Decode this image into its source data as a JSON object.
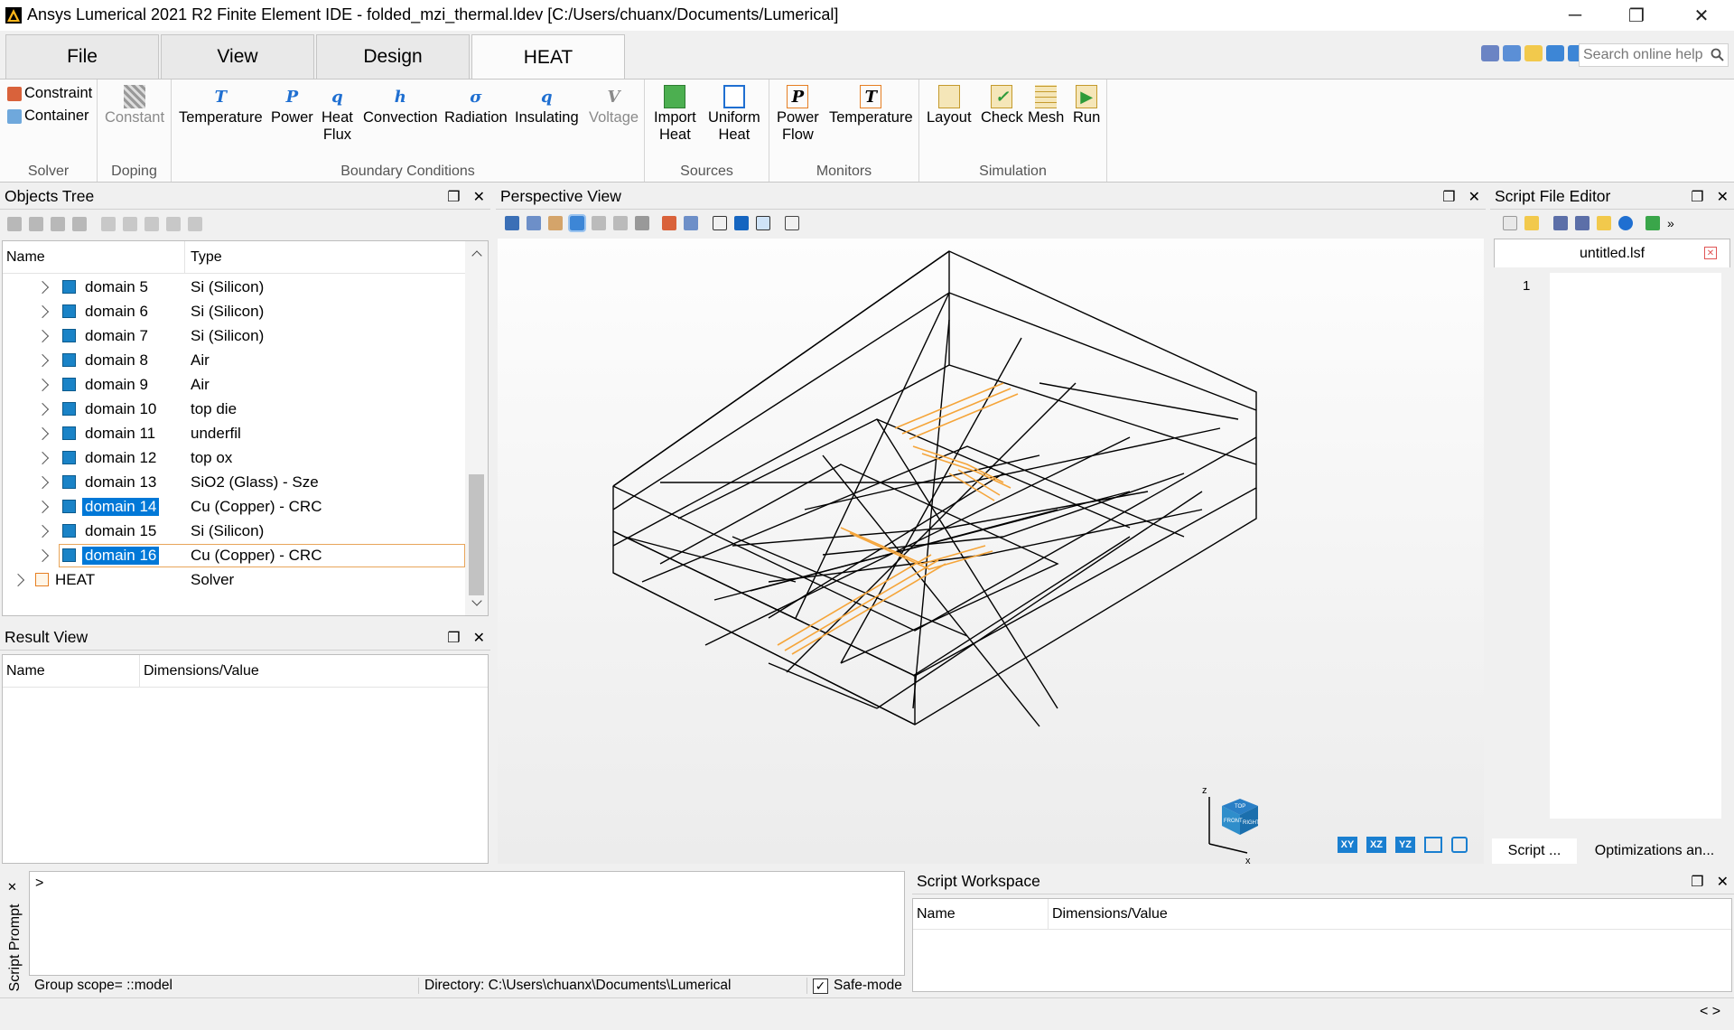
{
  "window": {
    "title": "Ansys Lumerical 2021 R2 Finite Element IDE - folded_mzi_thermal.ldev [C:/Users/chuanx/Documents/Lumerical]",
    "minimize": "─",
    "maximize": "❐",
    "close": "✕"
  },
  "tabs": [
    {
      "label": "File"
    },
    {
      "label": "View"
    },
    {
      "label": "Design"
    },
    {
      "label": "HEAT",
      "active": true
    }
  ],
  "search": {
    "placeholder": "Search online help"
  },
  "ribbon": {
    "groups": [
      "Solver",
      "Doping",
      "Boundary Conditions",
      "Sources",
      "Monitors",
      "Simulation"
    ],
    "solver": [
      "Constraint",
      "Container"
    ],
    "doping": [
      {
        "label": "Constant",
        "disabled": true
      }
    ],
    "boundary": [
      {
        "label": "Temperature",
        "icon": "T"
      },
      {
        "label": "Power",
        "icon": "P"
      },
      {
        "label": "Heat\nFlux",
        "icon": "q"
      },
      {
        "label": "Convection",
        "icon": "h"
      },
      {
        "label": "Radiation",
        "icon": "σ"
      },
      {
        "label": "Insulating",
        "icon": "q"
      },
      {
        "label": "Voltage",
        "icon": "V",
        "disabled": true
      }
    ],
    "sources": [
      {
        "label": "Import\nHeat"
      },
      {
        "label": "Uniform\nHeat"
      }
    ],
    "monitors": [
      {
        "label": "Power\nFlow",
        "icon": "P"
      },
      {
        "label": "Temperature",
        "icon": "T"
      }
    ],
    "simulation": [
      {
        "label": "Layout"
      },
      {
        "label": "Check"
      },
      {
        "label": "Mesh"
      },
      {
        "label": "Run"
      }
    ]
  },
  "objects_tree": {
    "title": "Objects Tree",
    "col_name": "Name",
    "col_type": "Type",
    "rows": [
      {
        "name": "domain 5",
        "type": "Si (Silicon)"
      },
      {
        "name": "domain 6",
        "type": "Si (Silicon)"
      },
      {
        "name": "domain 7",
        "type": "Si (Silicon)"
      },
      {
        "name": "domain 8",
        "type": "Air"
      },
      {
        "name": "domain 9",
        "type": "Air"
      },
      {
        "name": "domain 10",
        "type": "top die"
      },
      {
        "name": "domain 11",
        "type": "underfil"
      },
      {
        "name": "domain 12",
        "type": "top ox"
      },
      {
        "name": "domain 13",
        "type": "SiO2 (Glass) - Sze"
      },
      {
        "name": "domain 14",
        "type": "Cu (Copper) - CRC",
        "selected": true
      },
      {
        "name": "domain 15",
        "type": "Si (Silicon)"
      },
      {
        "name": "domain 16",
        "type": "Cu (Copper) - CRC",
        "selected": true,
        "focused": true
      }
    ],
    "solver_row": {
      "name": "HEAT",
      "type": "Solver"
    }
  },
  "result_view": {
    "title": "Result View",
    "col_name": "Name",
    "col_value": "Dimensions/Value"
  },
  "perspective": {
    "title": "Perspective View",
    "view_buttons": [
      "XY",
      "XZ",
      "YZ"
    ],
    "axes": {
      "z": "z",
      "x": "x"
    },
    "gizmo": {
      "top": "TOP",
      "front": "FRONT",
      "right": "RIGHT"
    }
  },
  "script_editor": {
    "title": "Script File Editor",
    "file_tab": "untitled.lsf",
    "line1": "1",
    "bottom_tabs": [
      "Script ...",
      "Optimizations an..."
    ]
  },
  "script_prompt": {
    "side_label": "Script Prompt",
    "prompt": ">",
    "group_scope": "Group scope= ::model",
    "directory": "Directory: C:\\Users\\chuanx\\Documents\\Lumerical",
    "safe_mode": "Safe-mode",
    "safe_mode_checked": true
  },
  "script_workspace": {
    "title": "Script Workspace",
    "col_name": "Name",
    "col_value": "Dimensions/Value"
  },
  "statusbar": {
    "nav": "< >"
  },
  "colors": {
    "selection": "#0078d7",
    "orange": "#f5a53a",
    "accent_blue": "#1f6fd1"
  }
}
